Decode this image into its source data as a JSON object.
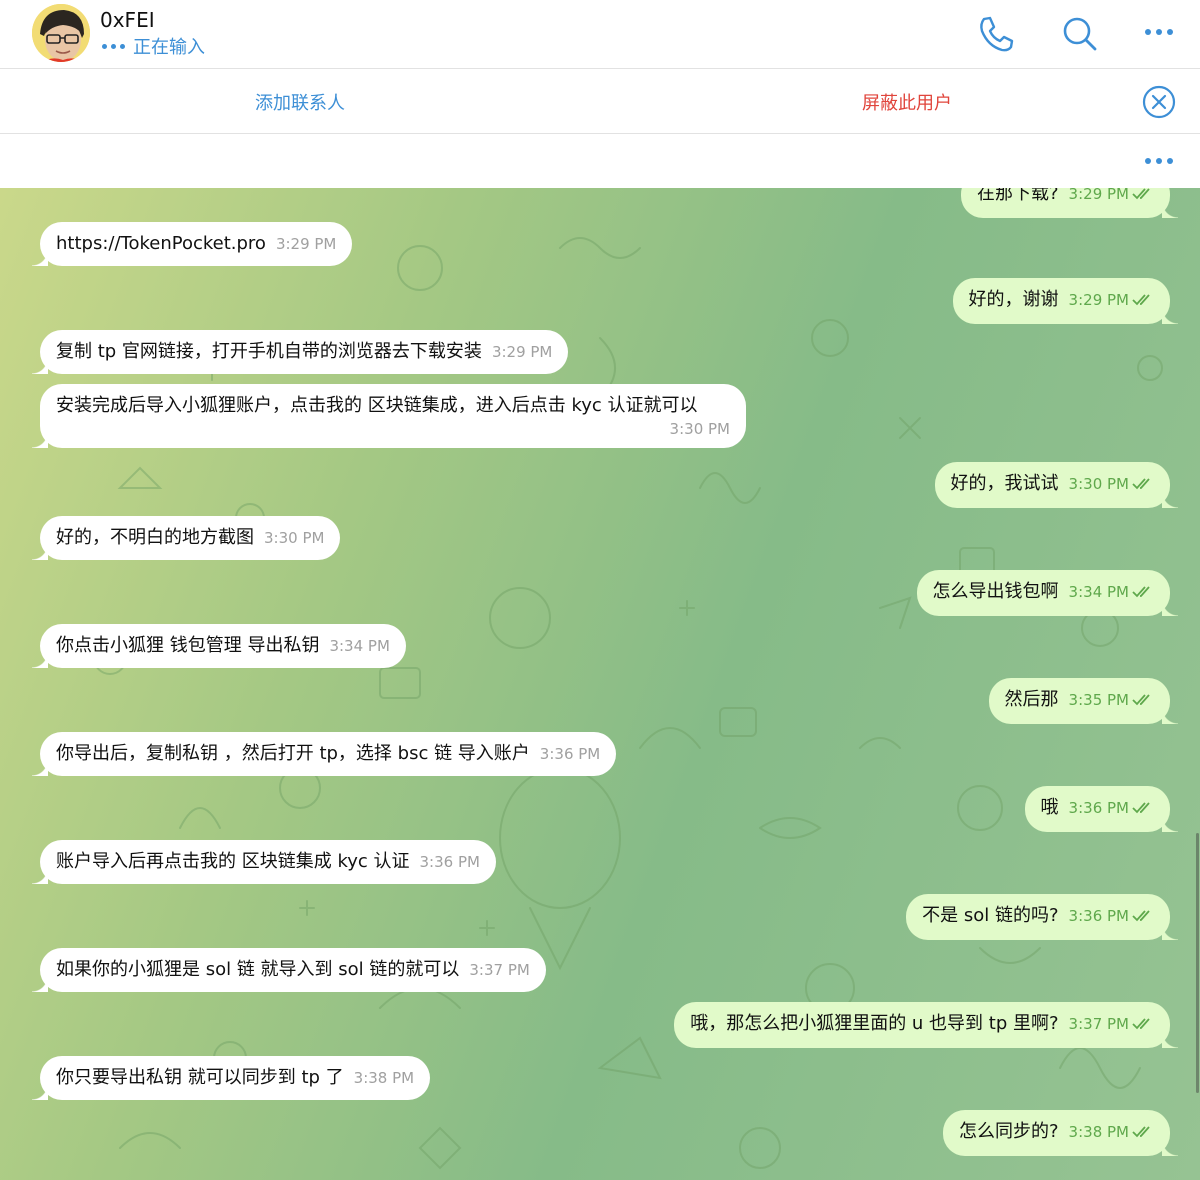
{
  "header": {
    "contact_name": "0xFEI",
    "status": "正在输入",
    "icons": {
      "call": "phone-icon",
      "search": "search-icon",
      "more": "more-icon"
    }
  },
  "action_bar": {
    "add_contact": "添加联系人",
    "block_user": "屏蔽此用户",
    "close_icon": "close-circle-icon"
  },
  "colors": {
    "accent": "#3d8fd6",
    "danger": "#e0453c",
    "incoming_bubble": "#ffffff",
    "outgoing_bubble": "#e1fac9",
    "outgoing_time": "#5fa84c",
    "wallpaper": [
      "#cad88a",
      "#86bb88"
    ]
  },
  "messages": [
    {
      "dir": "out",
      "text": "在那下载?",
      "time": "3:29 PM",
      "read": true
    },
    {
      "dir": "in",
      "text": "https://TokenPocket.pro",
      "time": "3:29 PM"
    },
    {
      "dir": "out",
      "text": "好的，谢谢",
      "time": "3:29 PM",
      "read": true
    },
    {
      "dir": "in",
      "text": "复制 tp 官网链接，打开手机自带的浏览器去下载安装",
      "time": "3:29 PM"
    },
    {
      "dir": "in",
      "text": "安装完成后导入小狐狸账户，点击我的  区块链集成，进入后点击 kyc  认证就可以",
      "time": "3:30 PM"
    },
    {
      "dir": "out",
      "text": "好的，我试试",
      "time": "3:30 PM",
      "read": true
    },
    {
      "dir": "in",
      "text": "好的，不明白的地方截图",
      "time": "3:30 PM"
    },
    {
      "dir": "out",
      "text": "怎么导出钱包啊",
      "time": "3:34 PM",
      "read": true
    },
    {
      "dir": "in",
      "text": "你点击小狐狸 钱包管理  导出私钥",
      "time": "3:34 PM"
    },
    {
      "dir": "out",
      "text": "然后那",
      "time": "3:35 PM",
      "read": true
    },
    {
      "dir": "in",
      "text": "你导出后，复制私钥 ，然后打开 tp，选择 bsc 链   导入账户",
      "time": "3:36 PM"
    },
    {
      "dir": "out",
      "text": "哦",
      "time": "3:36 PM",
      "read": true
    },
    {
      "dir": "in",
      "text": "账户导入后再点击我的  区块链集成    kyc 认证",
      "time": "3:36 PM"
    },
    {
      "dir": "out",
      "text": "不是 sol 链的吗?",
      "time": "3:36 PM",
      "read": true
    },
    {
      "dir": "in",
      "text": "如果你的小狐狸是 sol 链 就导入到 sol 链的就可以",
      "time": "3:37 PM"
    },
    {
      "dir": "out",
      "text": "哦，那怎么把小狐狸里面的 u 也导到 tp 里啊?",
      "time": "3:37 PM",
      "read": true
    },
    {
      "dir": "in",
      "text": "你只要导出私钥  就可以同步到 tp 了",
      "time": "3:38 PM"
    },
    {
      "dir": "out",
      "text": "怎么同步的?",
      "time": "3:38 PM",
      "read": true
    }
  ]
}
